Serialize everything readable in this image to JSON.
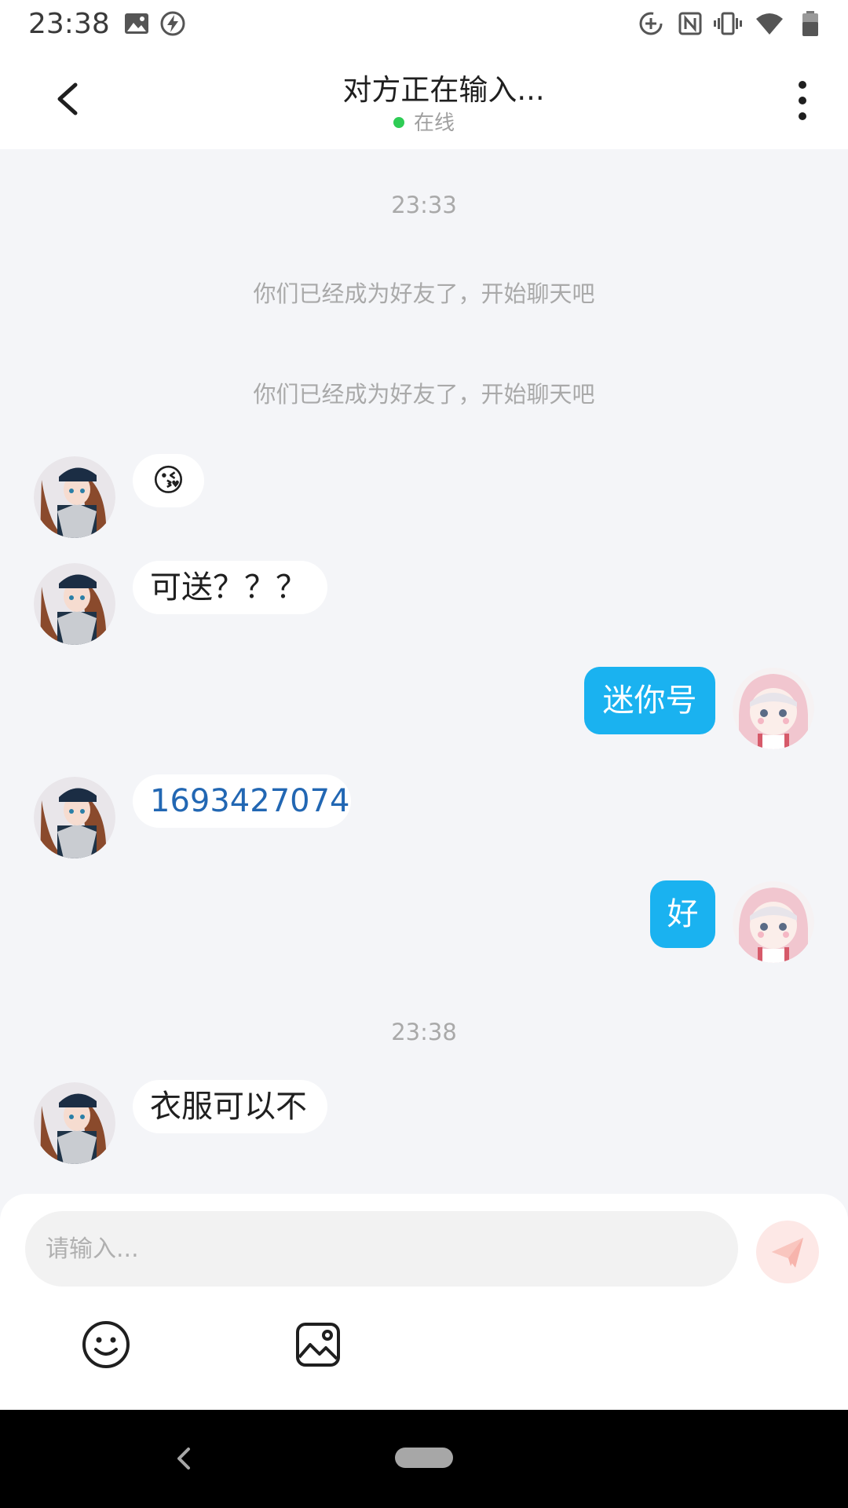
{
  "status_bar": {
    "time": "23:38"
  },
  "header": {
    "title": "对方正在输入...",
    "status": "在线",
    "online_color": "#2ecc55"
  },
  "chat": {
    "timestamp_1": "23:33",
    "system_message_1": "你们已经成为好友了，开始聊天吧",
    "system_message_2": "你们已经成为好友了，开始聊天吧",
    "messages": [
      {
        "side": "in",
        "text": "😘"
      },
      {
        "side": "in",
        "text": "可送？？？"
      },
      {
        "side": "out",
        "text": "迷你号"
      },
      {
        "side": "in",
        "text": "1693427074"
      },
      {
        "side": "out",
        "text": "好"
      }
    ],
    "timestamp_2": "23:38",
    "last_message": {
      "side": "in",
      "text": "衣服可以不"
    }
  },
  "input_panel": {
    "placeholder": "请输入...",
    "send_icon": "paper-plane-icon",
    "tools": [
      "smiley-icon",
      "image-icon"
    ]
  },
  "colors": {
    "outgoing_bubble": "#1ab2f0",
    "link_text": "#2267b3",
    "chat_background": "#f4f5f8"
  }
}
